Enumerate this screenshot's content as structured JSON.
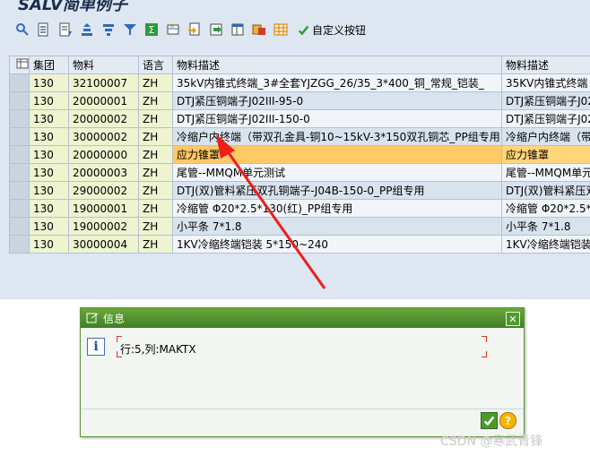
{
  "window": {
    "title": "SALV简单例子"
  },
  "toolbar": {
    "buttons": [
      {
        "name": "details-icon",
        "color": "#2e6db5"
      },
      {
        "name": "sort-ascending-icon",
        "color": "#2e6db5"
      },
      {
        "name": "sort-descending-icon",
        "color": "#2e6db5"
      },
      {
        "name": "filter-set-icon",
        "color": "#2e6db5"
      },
      {
        "name": "filter-icon",
        "color": "#2e6db5"
      },
      {
        "name": "sum-icon",
        "color": "#2e6db5"
      },
      {
        "name": "subtotal-icon",
        "color": "#2e6db5"
      },
      {
        "name": "print-icon",
        "color": "#2e6db5"
      },
      {
        "name": "export-icon",
        "color": "#2e6db5"
      },
      {
        "name": "layout-icon",
        "color": "#2e6db5"
      },
      {
        "name": "choose-layout-icon",
        "color": "#2e6db5"
      },
      {
        "name": "spreadsheet-icon",
        "color": "#d27a00"
      }
    ],
    "custom_button_label": "自定义按钮"
  },
  "grid": {
    "columns": [
      "集团",
      "物料",
      "语言",
      "物料描述",
      "物料描述"
    ],
    "rows": [
      [
        "130",
        "32100007",
        "ZH",
        "35kV内锥式终端_3#全套YJZGG_26/35_3*400_铜_常规_铠装_",
        "35KV内锥式终端"
      ],
      [
        "130",
        "20000001",
        "ZH",
        "DTJ紧压铜端子J02III-95-0",
        "DTJ紧压铜端子J02"
      ],
      [
        "130",
        "20000002",
        "ZH",
        "DTJ紧压铜端子J02III-150-0",
        "DTJ紧压铜端子J02"
      ],
      [
        "130",
        "30000002",
        "ZH",
        "冷缩户内终端（带双孔金具-铜10~15kV-3*150双孔铜芯_PP组专用",
        "冷缩户内终端（带"
      ],
      [
        "130",
        "20000000",
        "ZH",
        "应力锥罩",
        "应力锥罩"
      ],
      [
        "130",
        "20000003",
        "ZH",
        "尾管--MMQM单元测试",
        "尾管--MMQM单元测"
      ],
      [
        "130",
        "29000002",
        "ZH",
        "DTJ(双)管料紧压双孔铜端子-J04B-150-0_PP组专用",
        "DTJ(双)管料紧压双"
      ],
      [
        "130",
        "19000001",
        "ZH",
        "冷缩管 Φ20*2.5*130(红)_PP组专用",
        "冷缩管 Φ20*2.5*"
      ],
      [
        "130",
        "19000002",
        "ZH",
        "小平条 7*1.8",
        "小平条 7*1.8"
      ],
      [
        "130",
        "30000004",
        "ZH",
        "1KV冷缩终端铠装 5*150~240",
        "1KV冷缩终端铠装"
      ]
    ],
    "highlight_row": 4
  },
  "dialog": {
    "title": "信息",
    "message": "行:5,列:MAKTX",
    "accent": "#4f9c2c"
  },
  "watermark": "CSDN @寒武青锋"
}
